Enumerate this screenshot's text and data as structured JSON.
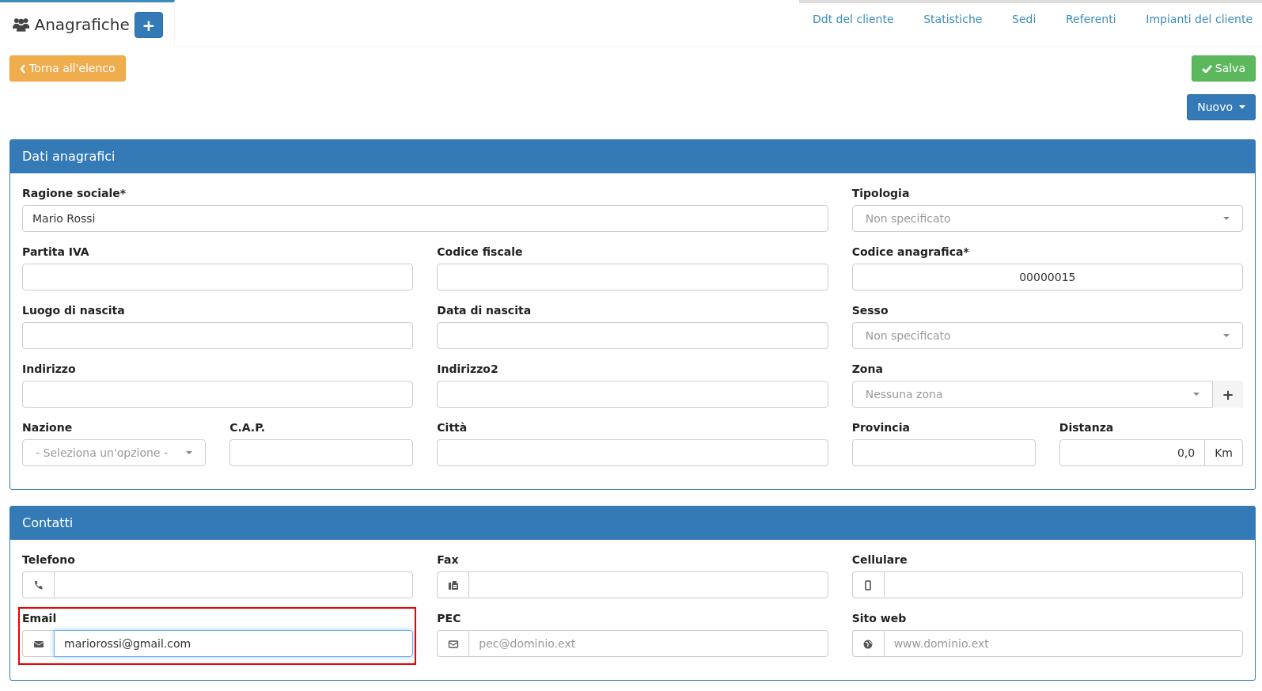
{
  "header": {
    "title": "Anagrafiche",
    "add_label": "+"
  },
  "links": [
    {
      "label": "Ddt del cliente"
    },
    {
      "label": "Statistiche"
    },
    {
      "label": "Sedi"
    },
    {
      "label": "Referenti"
    },
    {
      "label": "Impianti del cliente"
    }
  ],
  "back_button": "Torna all'elenco",
  "save_button": "Salva",
  "new_button": "Nuovo",
  "panels": [
    {
      "title": "Dati anagrafici",
      "rows": [
        [
          {
            "label": "Ragione sociale*",
            "kind": "text",
            "value": "Mario Rossi"
          },
          "",
          {
            "label": "Tipologia",
            "kind": "select",
            "placeholder": "Non specificato"
          }
        ],
        [
          {
            "label": "Partita IVA",
            "kind": "text"
          },
          {
            "label": "Codice fiscale",
            "kind": "text"
          },
          {
            "label": "Codice anagrafica*",
            "kind": "code",
            "value": "00000015"
          }
        ],
        [
          {
            "label": "Luogo di nascita",
            "kind": "text"
          },
          {
            "label": "Data di nascita",
            "kind": "text"
          },
          {
            "label": "Sesso",
            "kind": "select",
            "placeholder": "Non specificato"
          }
        ],
        [
          {
            "label": "Indirizzo",
            "kind": "text"
          },
          {
            "label": "Indirizzo2",
            "kind": "text"
          },
          {
            "label": "Zona",
            "kind": "select_add",
            "placeholder": "Nessuna zona",
            "add_label": "+"
          }
        ],
        [
          {
            "kind": "pair",
            "fields": [
              {
                "label": "Nazione",
                "kind": "select",
                "placeholder": "- Seleziona un'opzione -"
              },
              {
                "label": "C.A.P.",
                "kind": "text"
              }
            ]
          },
          {
            "label": "Città",
            "kind": "text"
          },
          {
            "kind": "pair",
            "fields": [
              {
                "label": "Provincia",
                "kind": "text"
              },
              {
                "label": "Distanza",
                "kind": "unit",
                "value": "0,0",
                "unit": "Km"
              }
            ]
          }
        ]
      ]
    },
    {
      "title": "Contatti",
      "rows": [
        [
          {
            "label": "Telefono",
            "kind": "icon",
            "focused": false,
            "highlighted": false
          },
          {
            "label": "Fax",
            "kind": "icon",
            "focused": false,
            "highlighted": false
          },
          {
            "label": "Cellulare",
            "kind": "icon",
            "focused": false,
            "highlighted": false
          }
        ],
        [
          {
            "label": "Email",
            "kind": "icon",
            "value": "mariorossi@gmail.com",
            "focused": true,
            "highlighted": true
          },
          {
            "label": "PEC",
            "kind": "icon",
            "placeholder": "pec@dominio.ext",
            "focused": false,
            "highlighted": false
          },
          {
            "label": "Sito web",
            "kind": "icon",
            "placeholder": "www.dominio.ext",
            "focused": false,
            "highlighted": false
          }
        ]
      ]
    }
  ]
}
